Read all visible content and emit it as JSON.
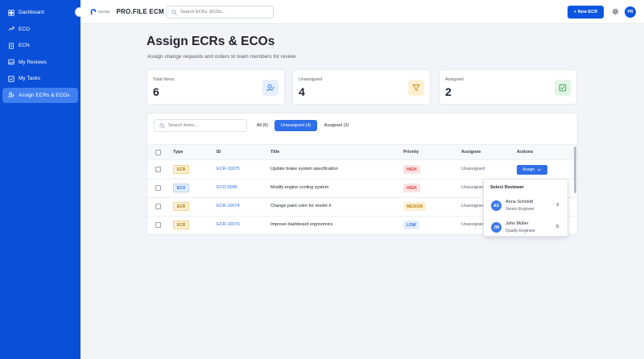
{
  "sidebar": {
    "items": [
      {
        "label": "Dashboard",
        "icon": "dashboard-icon"
      },
      {
        "label": "ECO",
        "icon": "trend-icon"
      },
      {
        "label": "ECN",
        "icon": "document-icon"
      },
      {
        "label": "My Reviews",
        "icon": "image-icon"
      },
      {
        "label": "My Tasks",
        "icon": "checkbox-icon"
      },
      {
        "label": "Assign ECRs & ECOs",
        "icon": "user-assign-icon"
      }
    ],
    "active_index": 5,
    "background": "#0a4fd8"
  },
  "header": {
    "logo_text": "revolze",
    "app_title": "PRO.FILE ECM",
    "search_placeholder": "Search ECRs, ECOs...",
    "new_button": "+ New ECR",
    "avatar_initials": "PR"
  },
  "page": {
    "title": "Assign ECRs & ECOs",
    "subtitle": "Assign change requests and orders to team members for review"
  },
  "stats": [
    {
      "label": "Total Items",
      "value": "6",
      "icon": "user-check-icon",
      "color": "#e6effd"
    },
    {
      "label": "Unassigned",
      "value": "4",
      "icon": "filter-icon",
      "color": "#fdf0d2"
    },
    {
      "label": "Assigned",
      "value": "2",
      "icon": "check-square-icon",
      "color": "#e2f5e7"
    }
  ],
  "table": {
    "search_placeholder": "Search items...",
    "filters": [
      {
        "label": "All (6)",
        "active": false
      },
      {
        "label": "Unassigned (4)",
        "active": true
      },
      {
        "label": "Assigned (2)",
        "active": false
      }
    ],
    "columns": [
      "Type",
      "ID",
      "Title",
      "Priority",
      "Assignee",
      "Actions"
    ],
    "rows": [
      {
        "type": "ECR",
        "id": "ECR-10075",
        "title": "Update brake system specification",
        "priority": "HIGH",
        "assignee": "Unassigned",
        "action": "Assign"
      },
      {
        "type": "ECO",
        "id": "ECO-5045",
        "title": "Modify engine cooling system",
        "priority": "HIGH",
        "assignee": "Unassigned"
      },
      {
        "type": "ECR",
        "id": "ECR-10074",
        "title": "Change paint color for model X",
        "priority": "MEDIUM",
        "assignee": "Unassigned"
      },
      {
        "type": "ECR",
        "id": "ECR-10073",
        "title": "Improve dashboard ergonomics",
        "priority": "LOW",
        "assignee": "Unassigned"
      }
    ]
  },
  "reviewer_dropdown": {
    "title": "Select Reviewer",
    "reviewers": [
      {
        "initials": "AS",
        "name": "Anna Schmidt",
        "role": "Senior Engineer",
        "count": "3"
      },
      {
        "initials": "JM",
        "name": "John Müller",
        "role": "Quality Engineer",
        "count": "5"
      }
    ]
  }
}
